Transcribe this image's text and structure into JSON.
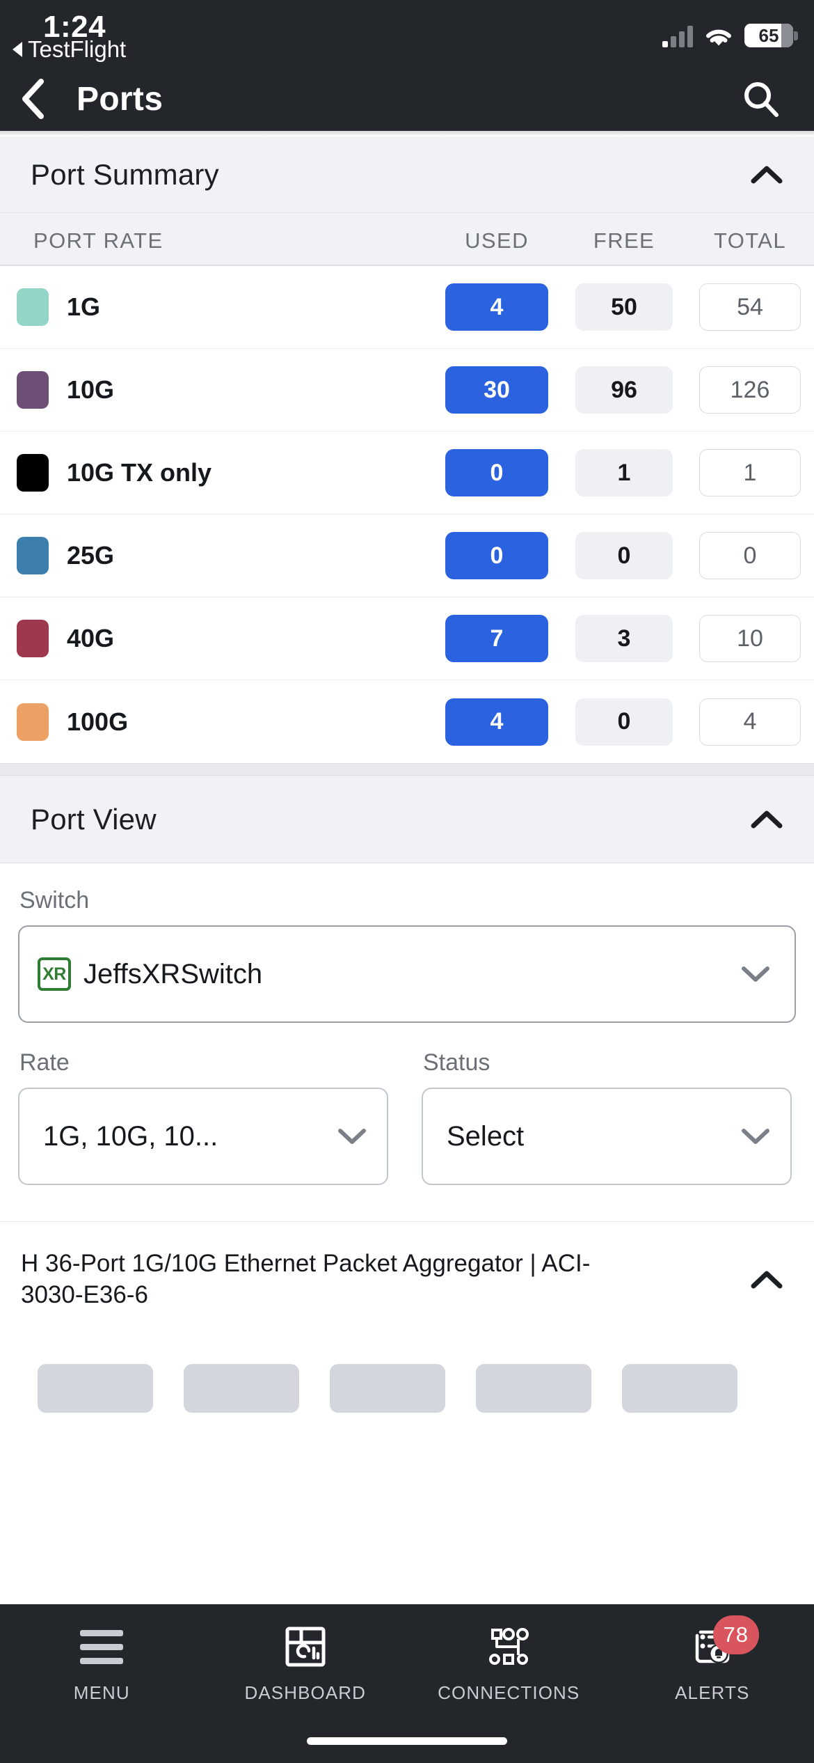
{
  "status_bar": {
    "time": "1:24",
    "back_app": "TestFlight",
    "battery_percent": "65",
    "signal_icon": "cellular-signal-icon",
    "wifi_icon": "wifi-icon"
  },
  "nav": {
    "back_icon": "chevron-left-icon",
    "title": "Ports",
    "search_icon": "search-icon"
  },
  "port_summary": {
    "title": "Port Summary",
    "collapse_icon": "chevron-up-icon",
    "columns": [
      "PORT RATE",
      "USED",
      "FREE",
      "TOTAL"
    ],
    "rows": [
      {
        "rate": "1G",
        "color": "#93d5c6",
        "used": "4",
        "free": "50",
        "total": "54"
      },
      {
        "rate": "10G",
        "color": "#6d4f75",
        "used": "30",
        "free": "96",
        "total": "126"
      },
      {
        "rate": "10G TX only",
        "color": "#000000",
        "used": "0",
        "free": "1",
        "total": "1"
      },
      {
        "rate": "25G",
        "color": "#3c7fad",
        "used": "0",
        "free": "0",
        "total": "0"
      },
      {
        "rate": "40G",
        "color": "#9e384c",
        "used": "7",
        "free": "3",
        "total": "10"
      },
      {
        "rate": "100G",
        "color": "#eda063",
        "used": "4",
        "free": "0",
        "total": "4"
      }
    ]
  },
  "port_view": {
    "title": "Port View",
    "collapse_icon": "chevron-up-icon",
    "switch_label": "Switch",
    "switch_value": "JeffsXRSwitch",
    "switch_badge": "XR",
    "switch_badge_color": "#2e7d32",
    "switch_chevron_icon": "chevron-down-icon",
    "rate_label": "Rate",
    "rate_value": "1G, 10G, 10...",
    "rate_chevron_icon": "chevron-down-icon",
    "status_label": "Status",
    "status_value": "Select",
    "status_chevron_icon": "chevron-down-icon",
    "device_description": "H 36-Port 1G/10G Ethernet Packet Aggregator | ACI-3030-E36-6",
    "device_collapse_icon": "chevron-up-icon"
  },
  "tab_bar": {
    "items": [
      {
        "label": "MENU",
        "icon": "hamburger-menu-icon",
        "badge": null
      },
      {
        "label": "DASHBOARD",
        "icon": "dashboard-grid-icon",
        "badge": null
      },
      {
        "label": "CONNECTIONS",
        "icon": "network-nodes-icon",
        "badge": null
      },
      {
        "label": "ALERTS",
        "icon": "alert-bell-list-icon",
        "badge": "78"
      }
    ],
    "badge_color": "#d9555e"
  },
  "theme": {
    "header_bg": "#23262b",
    "accent_blue": "#2b62e0",
    "section_bg": "#f1f2f6"
  }
}
